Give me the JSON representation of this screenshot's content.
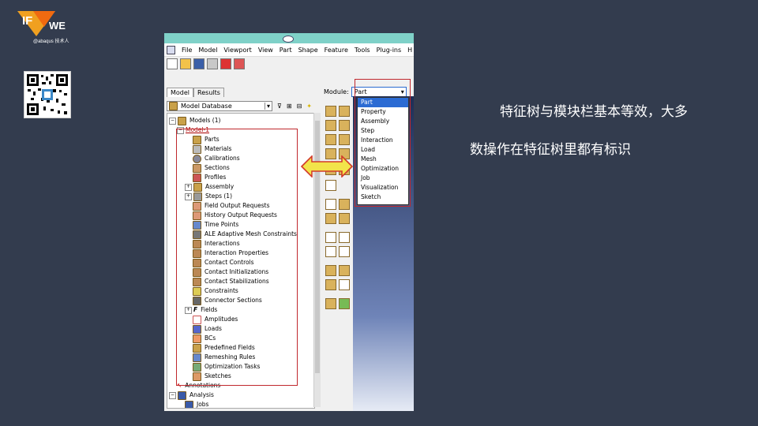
{
  "logo": {
    "mark": "IF",
    "suffix": "WE",
    "tagline": "@abaqus 技术人"
  },
  "menu": [
    "File",
    "Model",
    "Viewport",
    "View",
    "Part",
    "Shape",
    "Feature",
    "Tools",
    "Plug-ins",
    "H"
  ],
  "tabs": [
    "Model",
    "Results"
  ],
  "model_db": "Model Database",
  "module_label": "Module:",
  "module_value": "Part",
  "module_options": [
    "Part",
    "Property",
    "Assembly",
    "Step",
    "Interaction",
    "Load",
    "Mesh",
    "Optimization",
    "Job",
    "Visualization",
    "Sketch"
  ],
  "tree": {
    "models": "Models (1)",
    "model1": "Model-1",
    "items": [
      "Parts",
      "Materials",
      "Calibrations",
      "Sections",
      "Profiles",
      "Assembly",
      "Steps (1)",
      "Field Output Requests",
      "History Output Requests",
      "Time Points",
      "ALE Adaptive Mesh Constraints",
      "Interactions",
      "Interaction Properties",
      "Contact Controls",
      "Contact Initializations",
      "Contact Stabilizations",
      "Constraints",
      "Connector Sections",
      "Fields",
      "Amplitudes",
      "Loads",
      "BCs",
      "Predefined Fields",
      "Remeshing Rules",
      "Optimization Tasks",
      "Sketches"
    ],
    "annotations": "Annotations",
    "analysis": "Analysis",
    "jobs": "Jobs"
  },
  "caption": {
    "line1": "特征树与模块栏基本等效，大多",
    "line2": "数操作在特征树里都有标识"
  },
  "colors": {
    "background": "#333c4e",
    "highlight": "#c0282d",
    "selection": "#2b6bd3",
    "arrow": "#f2e44a"
  }
}
